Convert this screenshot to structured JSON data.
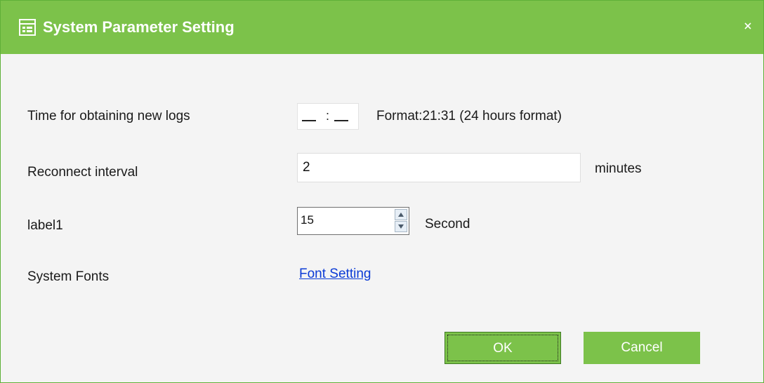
{
  "window": {
    "title": "System Parameter Setting",
    "title_icon": "settings-form-icon",
    "close_icon": "close-icon",
    "accent_color": "#7cc24a"
  },
  "fields": {
    "log_time": {
      "label": "Time for obtaining new logs",
      "separator": ":",
      "hint": "Format:21:31 (24 hours format)"
    },
    "reconnect": {
      "label": "Reconnect interval",
      "value": "2",
      "unit": "minutes"
    },
    "label1": {
      "label": "label1",
      "value": "15",
      "unit": "Second"
    },
    "fonts": {
      "label": "System Fonts",
      "link": "Font Setting"
    }
  },
  "buttons": {
    "ok": "OK",
    "cancel": "Cancel"
  }
}
